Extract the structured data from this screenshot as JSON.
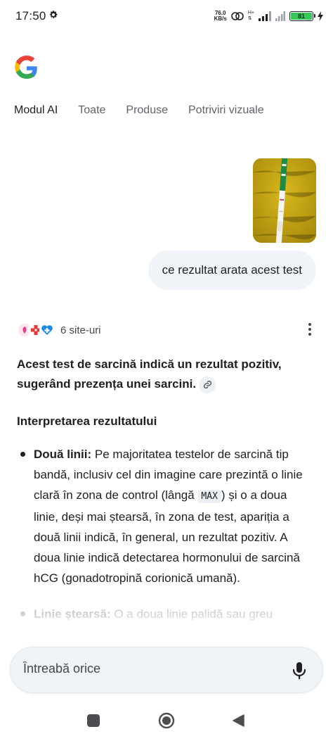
{
  "status_bar": {
    "time": "17:50",
    "net_speed_top": "76.0",
    "net_speed_bottom": "KB/s",
    "network_type": "H+",
    "battery": "81"
  },
  "tabs": [
    {
      "label": "Modul AI",
      "active": true
    },
    {
      "label": "Toate",
      "active": false
    },
    {
      "label": "Produse",
      "active": false
    },
    {
      "label": "Potriviri vizuale",
      "active": false
    }
  ],
  "user_query": "ce rezultat arata acest test",
  "sources_label": "6 site-uri",
  "answer": {
    "lead": "Acest test de sarcină indică un rezultat pozitiv, sugerând prezența unei sarcini.",
    "section_heading": "Interpretarea rezultatului",
    "bullet1_title": "Două linii:",
    "bullet1_text_a": " Pe majoritatea testelor de sarcină tip bandă, inclusiv cel din imagine care prezintă o linie clară în zona de control (lângă ",
    "bullet1_code": "MAX",
    "bullet1_text_b": ") și o a doua linie, deși mai ștearsă, în zona de test, apariția a două linii indică, în general, un rezultat pozitiv. A doua linie indică detectarea hormonului de sarcină hCG (gonadotropină corionică umană).",
    "bullet2_title": "Linie ștearsă:",
    "bullet2_text": " O a doua linie palidă sau greu"
  },
  "ask_placeholder": "Întreabă orice",
  "colors": {
    "accent_blue": "#4285f4",
    "bubble_bg": "#f0f4f9",
    "battery_green": "#34c759"
  },
  "icons": [
    "settings-icon",
    "google-logo",
    "more-vert-icon",
    "link-icon",
    "mic-icon",
    "recents-icon",
    "home-icon",
    "back-icon"
  ]
}
